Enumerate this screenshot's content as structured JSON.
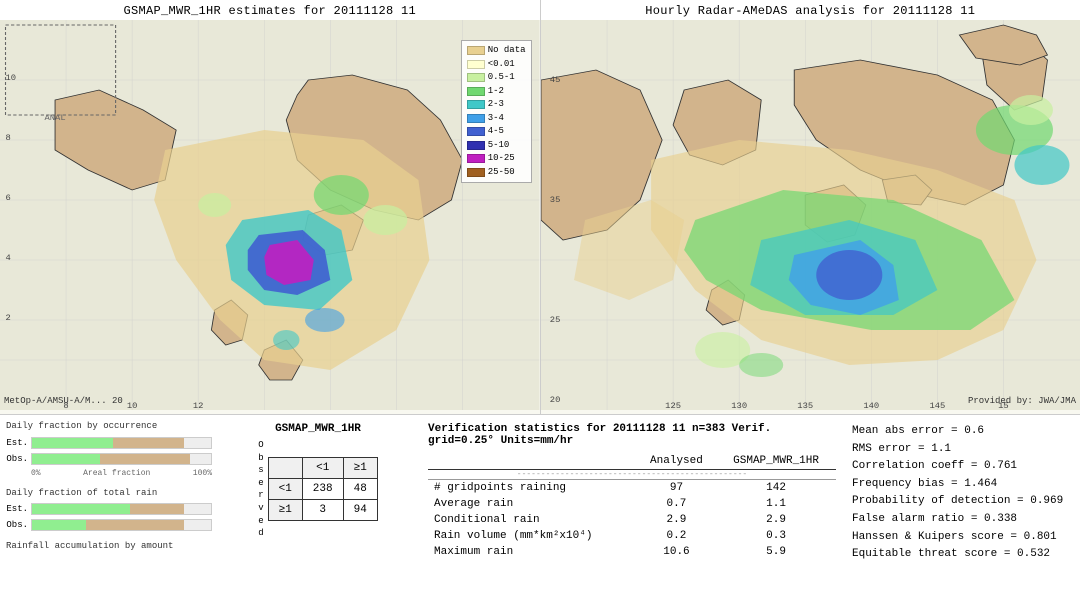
{
  "maps": {
    "left_title": "GSMAP_MWR_1HR estimates for 20111128 11",
    "right_title": "Hourly Radar-AMeDAS analysis for 20111128 11",
    "right_bottom_label": "Provided by: JWA/JMA",
    "left_bottom_label": "MetOp-A/AMSU-A/M... 20"
  },
  "legend": {
    "title": "No data",
    "items": [
      {
        "label": "No data",
        "color": "#E8D090"
      },
      {
        "label": "<0.01",
        "color": "#FFFFD0"
      },
      {
        "label": "0.5-1",
        "color": "#C8F0A0"
      },
      {
        "label": "1-2",
        "color": "#70D870"
      },
      {
        "label": "2-3",
        "color": "#40C8C8"
      },
      {
        "label": "3-4",
        "color": "#40A0E8"
      },
      {
        "label": "4-5",
        "color": "#4060D0"
      },
      {
        "label": "5-10",
        "color": "#3030B0"
      },
      {
        "label": "10-25",
        "color": "#C020C0"
      },
      {
        "label": "25-50",
        "color": "#A06020"
      }
    ]
  },
  "bar_charts": {
    "title1": "Daily fraction by occurrence",
    "title2": "Daily fraction of total rain",
    "title3": "Rainfall accumulation by amount",
    "est_label": "Est.",
    "obs_label": "Obs.",
    "axis_left": "0%",
    "axis_right": "100%",
    "axis_label": "Areal fraction"
  },
  "contingency": {
    "title": "GSMAP_MWR_1HR",
    "col_lt1": "<1",
    "col_ge1": "≥1",
    "row_lt1": "<1",
    "row_ge1": "≥1",
    "obs_label": "O\nb\ns\ne\nr\nv\ne\nd",
    "val_238": "238",
    "val_48": "48",
    "val_3": "3",
    "val_94": "94"
  },
  "verification": {
    "title": "Verification statistics for 20111128 11  n=383  Verif. grid=0.25°  Units=mm/hr",
    "col_analysed": "Analysed",
    "col_gsmap": "GSMAP_MWR_1HR",
    "divider": "--------------------------------------------",
    "rows": [
      {
        "label": "# gridpoints raining",
        "analysed": "97",
        "gsmap": "142"
      },
      {
        "label": "Average rain",
        "analysed": "0.7",
        "gsmap": "1.1"
      },
      {
        "label": "Conditional rain",
        "analysed": "2.9",
        "gsmap": "2.9"
      },
      {
        "label": "Rain volume (mm*km²x10⁴)",
        "analysed": "0.2",
        "gsmap": "0.3"
      },
      {
        "label": "Maximum rain",
        "analysed": "10.6",
        "gsmap": "5.9"
      }
    ]
  },
  "right_stats": {
    "mean_abs_error": "Mean abs error = 0.6",
    "rms_error": "RMS error = 1.1",
    "correlation": "Correlation coeff = 0.761",
    "freq_bias": "Frequency bias = 1.464",
    "prob_detection": "Probability of detection = 0.969",
    "false_alarm": "False alarm ratio = 0.338",
    "hanssen_kuipers": "Hanssen & Kuipers score = 0.801",
    "equitable_threat": "Equitable threat score = 0.532"
  }
}
